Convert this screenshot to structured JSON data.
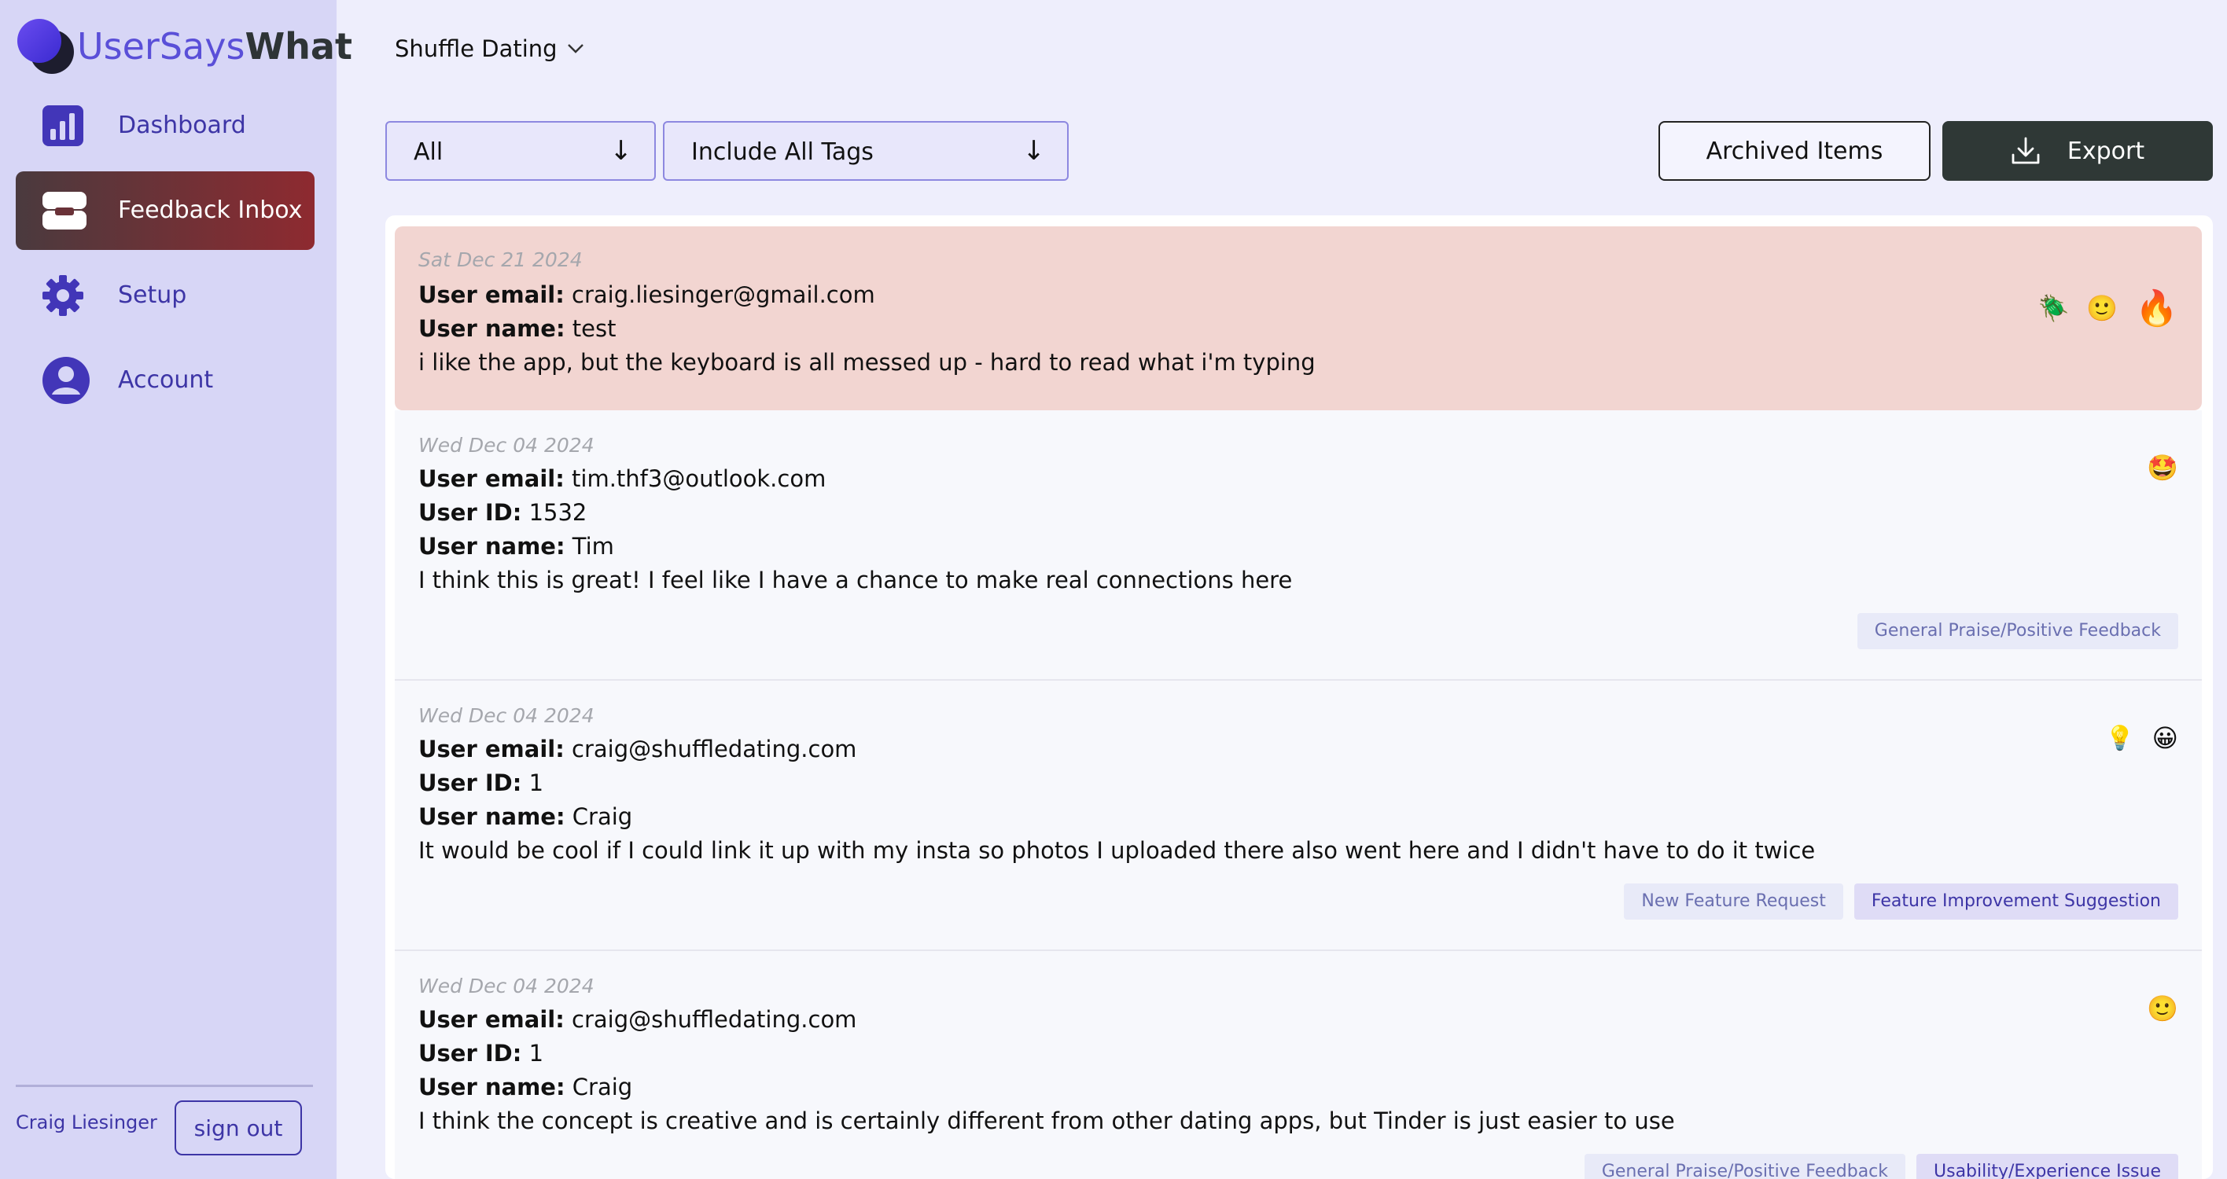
{
  "brand": {
    "part1": "UserSays",
    "part2": "What"
  },
  "sidebar": {
    "items": [
      {
        "label": "Dashboard",
        "icon": "bar-chart-icon"
      },
      {
        "label": "Feedback Inbox",
        "icon": "inbox-tray-icon",
        "active": true
      },
      {
        "label": "Setup",
        "icon": "gear-icon"
      },
      {
        "label": "Account",
        "icon": "user-circle-icon"
      }
    ],
    "user_name": "Craig Liesinger",
    "signout_label": "sign out"
  },
  "header": {
    "app_name": "Shuffle Dating"
  },
  "filters": {
    "status": {
      "value": "All"
    },
    "tags": {
      "value": "Include All Tags"
    }
  },
  "actions": {
    "archived_label": "Archived Items",
    "export_label": "Export"
  },
  "labels": {
    "email": "User email:",
    "id": "User ID:",
    "name": "User name:"
  },
  "feedback": [
    {
      "date": "Sat Dec 21 2024",
      "email": "craig.liesinger@gmail.com",
      "name": "test",
      "message": "i like the app, but the keyboard is all messed up - hard to read what i'm typing",
      "emojis": [
        "🪲",
        "🙂",
        "🔥"
      ],
      "tags": []
    },
    {
      "date": "Wed Dec 04 2024",
      "email": "tim.thf3@outlook.com",
      "user_id": "1532",
      "name": "Tim",
      "message": "I think this is great! I feel like I have a chance to make real connections here",
      "emojis": [
        "🤩"
      ],
      "tags": [
        "General Praise/Positive Feedback"
      ]
    },
    {
      "date": "Wed Dec 04 2024",
      "email": "craig@shuffledating.com",
      "user_id": "1",
      "name": "Craig",
      "message": "It would be cool if I could link it up with my insta so photos I uploaded there also went here and I didn't have to do it twice",
      "emojis": [
        "💡",
        "😀"
      ],
      "tags": [
        "New Feature Request",
        "Feature Improvement Suggestion"
      ]
    },
    {
      "date": "Wed Dec 04 2024",
      "email": "craig@shuffledating.com",
      "user_id": "1",
      "name": "Craig",
      "message": "I think the concept is creative and is certainly different from other dating apps, but Tinder is just easier to use",
      "emojis": [
        "🙂"
      ],
      "tags": [
        "General Praise/Positive Feedback",
        "Usability/Experience Issue"
      ]
    }
  ],
  "colors": {
    "accent": "#3d35a6",
    "sidebar_bg": "#d7d6f6",
    "page_bg": "#eeeefc",
    "active_nav_start": "#4a3a3e",
    "active_nav_end": "#8e2a30",
    "export_bg": "#2f3836",
    "highlight_card": "#f2d5d1"
  }
}
